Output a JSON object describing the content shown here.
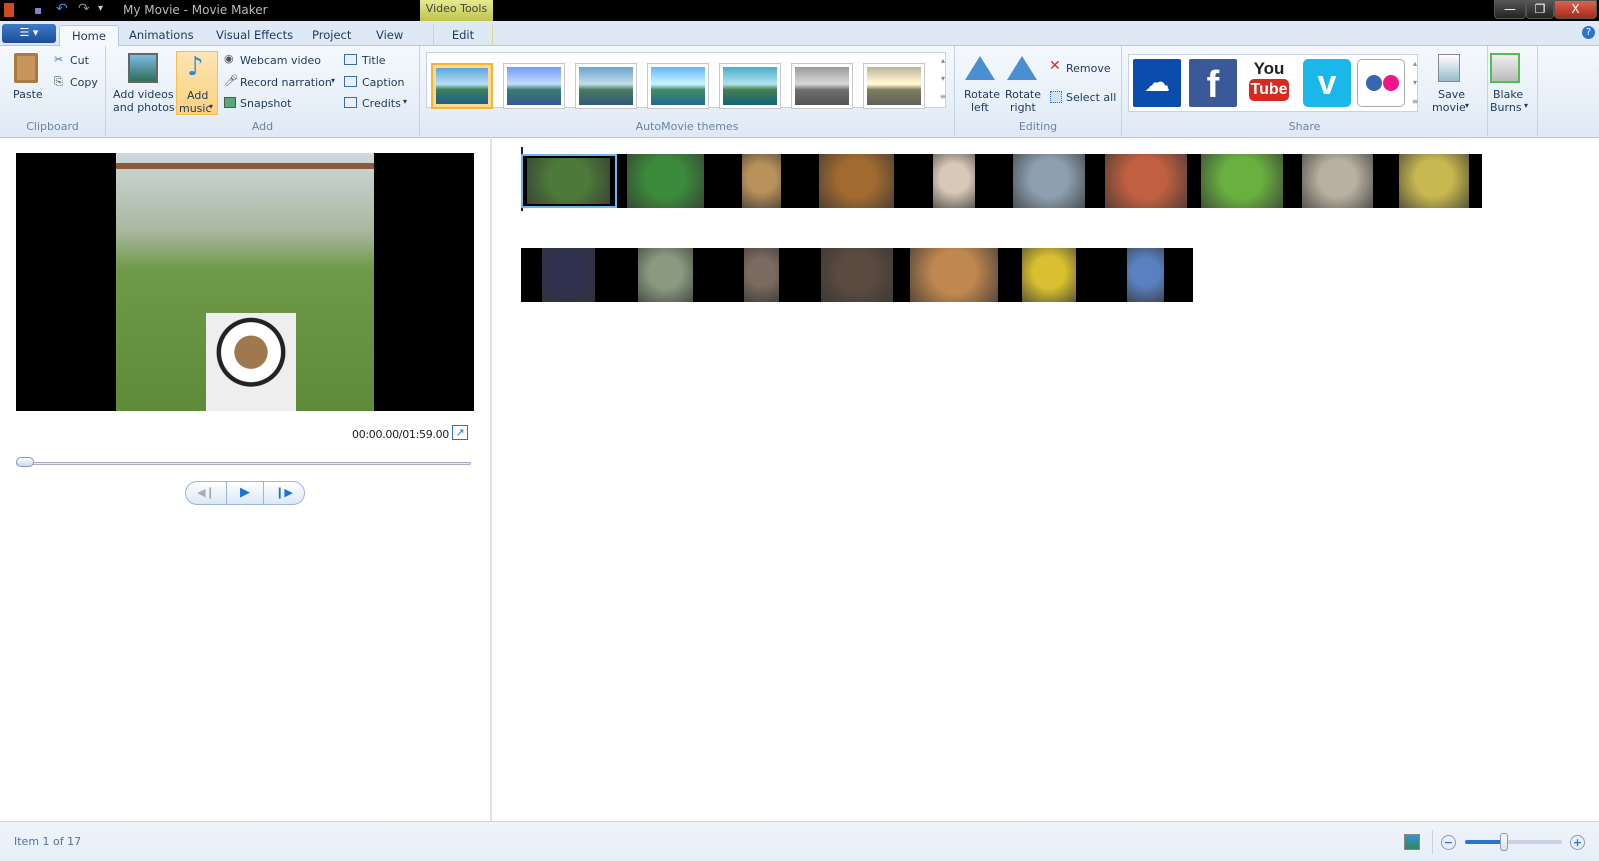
{
  "window": {
    "title": "My Movie - Movie Maker",
    "contextual_tab_group": "Video Tools",
    "minimize": "—",
    "restore": "❐",
    "close": "X"
  },
  "tabs": [
    {
      "label": "Home",
      "active": true
    },
    {
      "label": "Animations"
    },
    {
      "label": "Visual Effects"
    },
    {
      "label": "Project"
    },
    {
      "label": "View"
    },
    {
      "label": "Edit"
    }
  ],
  "ribbon": {
    "clipboard": {
      "label": "Clipboard",
      "paste": "Paste",
      "cut": "Cut",
      "copy": "Copy"
    },
    "add": {
      "label": "Add",
      "add_videos_1": "Add videos",
      "add_videos_2": "and photos",
      "add_music_1": "Add",
      "add_music_2": "music",
      "webcam": "Webcam video",
      "narration": "Record narration",
      "snapshot": "Snapshot",
      "title": "Title",
      "caption": "Caption",
      "credits": "Credits"
    },
    "themes": {
      "label": "AutoMovie themes",
      "count": 7
    },
    "editing": {
      "label": "Editing",
      "rotate_left_1": "Rotate",
      "rotate_left_2": "left",
      "rotate_right_1": "Rotate",
      "rotate_right_2": "right",
      "remove": "Remove",
      "select_all": "Select all"
    },
    "share": {
      "label": "Share",
      "services": [
        "OneDrive",
        "Facebook",
        "YouTube",
        "Vimeo",
        "Flickr"
      ],
      "youtube_1": "You",
      "youtube_2": "Tube",
      "save_movie_1": "Save",
      "save_movie_2": "movie"
    },
    "account": {
      "name_1": "Blake",
      "name_2": "Burns"
    }
  },
  "preview": {
    "time": "00:00.00/01:59.00",
    "progress": 0
  },
  "storyboard": {
    "total_items": 17,
    "selected": 1
  },
  "status": {
    "text": "Item 1 of 17",
    "zoom_level": 0.4
  },
  "colors": {
    "accent": "#1c4e9a",
    "selection": "#6cb8ee"
  }
}
